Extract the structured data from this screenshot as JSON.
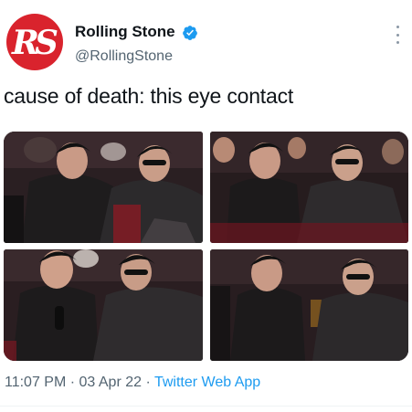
{
  "author": {
    "avatar_text": "RS",
    "name": "Rolling Stone",
    "handle": "@RollingStone",
    "verified_icon": "verified-badge-icon"
  },
  "tweet": {
    "text": "cause of death: this eye contact",
    "photos": [
      {
        "icon": "photo-1"
      },
      {
        "icon": "photo-2"
      },
      {
        "icon": "photo-3"
      },
      {
        "icon": "photo-4"
      }
    ]
  },
  "meta": {
    "time": "11:07 PM",
    "separator": " · ",
    "date": "03 Apr 22",
    "source": "Twitter Web App"
  },
  "colors": {
    "brand_red": "#d9232d",
    "verified_blue": "#1d9bf0",
    "link_blue": "#1d9bf0",
    "secondary_text": "#536471"
  }
}
